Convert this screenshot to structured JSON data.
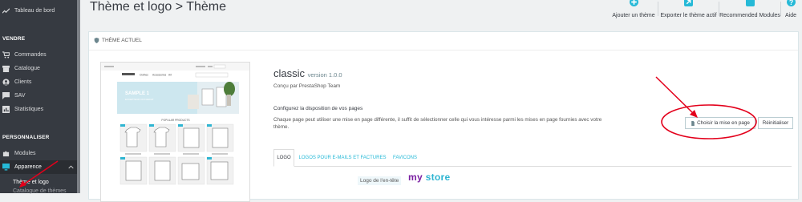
{
  "sidebar": {
    "items": [
      {
        "label": "Tableau de bord",
        "icon": "trending-up-icon"
      },
      {
        "label": "Commandes",
        "icon": "cart-icon"
      },
      {
        "label": "Catalogue",
        "icon": "store-icon"
      },
      {
        "label": "Clients",
        "icon": "person-icon"
      },
      {
        "label": "SAV",
        "icon": "chat-icon"
      },
      {
        "label": "Statistiques",
        "icon": "bar-chart-icon"
      },
      {
        "label": "Modules",
        "icon": "puzzle-icon"
      },
      {
        "label": "Apparence",
        "icon": "desktop-icon"
      }
    ],
    "sections": {
      "vendre": "VENDRE",
      "personnaliser": "PERSONNALISER"
    },
    "subitems": [
      "Thème et logo",
      "Catalogue de thèmes"
    ]
  },
  "header": {
    "title": "Thème et logo > Thème",
    "toolbar": [
      {
        "label": "Ajouter un thème",
        "icon": "add-circle-icon"
      },
      {
        "label": "Exporter le thème actif",
        "icon": "export-icon"
      },
      {
        "label": "Recommended Modules",
        "icon": "extension-icon"
      },
      {
        "label": "Aide",
        "icon": "help-icon"
      }
    ]
  },
  "panel": {
    "heading": "THÈME ACTUEL",
    "theme": {
      "name": "classic",
      "version": "version 1.0.0",
      "author": "Conçu par PrestaShop Team"
    },
    "layout": {
      "title": "Configurez la disposition de vos pages",
      "description": "Chaque page peut utiliser une mise en page différente, il suffit de sélectionner celle qui vous intéresse parmi les mises en page fournies avec votre thème.",
      "choose_button": "Choisir la mise en page",
      "reset_button": "Réinitialiser"
    },
    "tabs": [
      "LOGO",
      "LOGOS POUR E-MAILS ET FACTURES",
      "FAVICONS"
    ],
    "logo_label": "Logo de l'en-tête",
    "logo": {
      "my": "my",
      "store": "store"
    },
    "preview": {
      "nav": [
        "Clothes",
        "Accessories",
        "Art"
      ],
      "banner_title": "SAMPLE 1",
      "banner_subtitle": "EXCEPTEUR OCCAECAT",
      "section_label": "POPULAR PRODUCTS"
    }
  },
  "colors": {
    "accent": "#25b9d7",
    "sidebar": "#363a41",
    "annotation": "#e3001b"
  }
}
